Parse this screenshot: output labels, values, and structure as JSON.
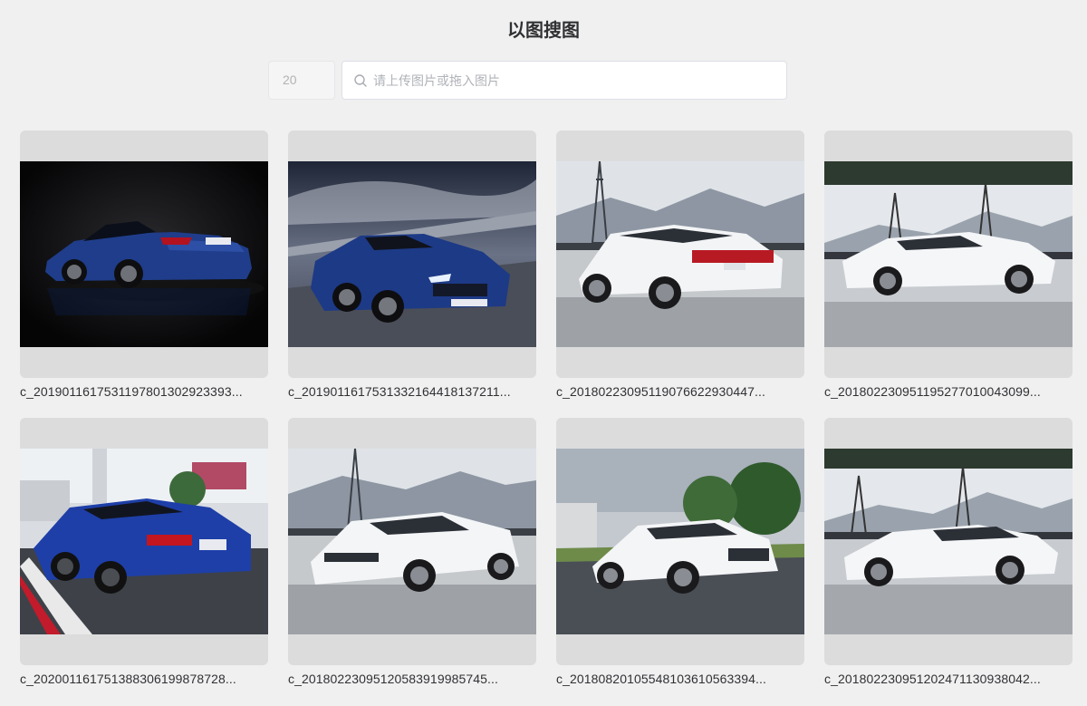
{
  "header": {
    "title": "以图搜图"
  },
  "search": {
    "count_value": "20",
    "placeholder": "请上传图片或拖入图片",
    "icon": "search-icon"
  },
  "results": [
    {
      "filename": "c_2019011617531197801302923393...",
      "image": "dark-blue-convertible-studio"
    },
    {
      "filename": "c_2019011617531332164418137211...",
      "image": "blue-convertible-racetrack"
    },
    {
      "filename": "c_2018022309511907662293044​7...",
      "image": "white-sedan-rear-mountains"
    },
    {
      "filename": "c_2018022309511952770100430​99...",
      "image": "white-sedan-side-mountains"
    },
    {
      "filename": "c_2020011617513883061998787​28...",
      "image": "blue-coupe-showroom"
    },
    {
      "filename": "c_2018022309512058391998574​5...",
      "image": "white-sedan-front-mountains"
    },
    {
      "filename": "c_2018082010554810361056339​4...",
      "image": "white-coupe-road-trees"
    },
    {
      "filename": "c_2018022309512024711309380​42...",
      "image": "white-sedan-side-pylon"
    }
  ]
}
